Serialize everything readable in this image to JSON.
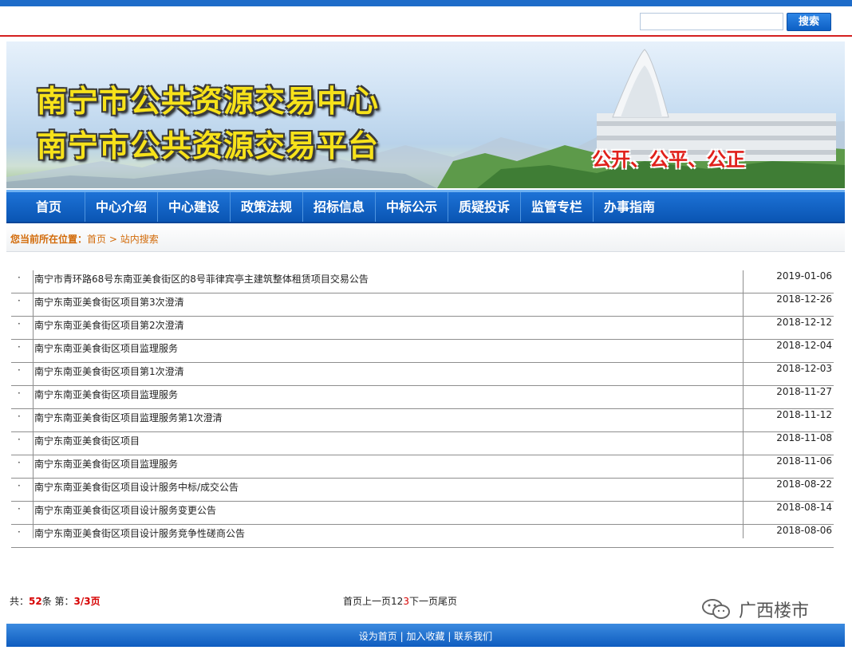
{
  "search": {
    "placeholder": "",
    "button_label": "搜索"
  },
  "banner": {
    "title_line1": "南宁市公共资源交易中心",
    "title_line2": "南宁市公共资源交易平台",
    "slogan": "公开、公平、公正"
  },
  "nav": {
    "items": [
      "首页",
      "中心介绍",
      "中心建设",
      "政策法规",
      "招标信息",
      "中标公示",
      "质疑投诉",
      "监管专栏",
      "办事指南"
    ]
  },
  "breadcrumb": {
    "label": "您当前所在位置：",
    "home": "首页",
    "separator": " > ",
    "current": "站内搜索"
  },
  "results": [
    {
      "bullet": "·",
      "title": "南宁市青环路68号东南亚美食街区的8号菲律宾亭主建筑整体租赁项目交易公告",
      "date": "2019-01-06"
    },
    {
      "bullet": "·",
      "title": "南宁东南亚美食街区项目第3次澄清",
      "date": "2018-12-26"
    },
    {
      "bullet": "·",
      "title": "南宁东南亚美食街区项目第2次澄清",
      "date": "2018-12-12"
    },
    {
      "bullet": "·",
      "title": "南宁东南亚美食街区项目监理服务",
      "date": "2018-12-04"
    },
    {
      "bullet": "·",
      "title": "南宁东南亚美食街区项目第1次澄清",
      "date": "2018-12-03"
    },
    {
      "bullet": "·",
      "title": "南宁东南亚美食街区项目监理服务",
      "date": "2018-11-27"
    },
    {
      "bullet": "·",
      "title": "南宁东南亚美食街区项目监理服务第1次澄清",
      "date": "2018-11-12"
    },
    {
      "bullet": "·",
      "title": "南宁东南亚美食街区项目",
      "date": "2018-11-08"
    },
    {
      "bullet": "·",
      "title": "南宁东南亚美食街区项目监理服务",
      "date": "2018-11-06"
    },
    {
      "bullet": "·",
      "title": "南宁东南亚美食街区项目设计服务中标/成交公告",
      "date": "2018-08-22"
    },
    {
      "bullet": "·",
      "title": "南宁东南亚美食街区项目设计服务变更公告",
      "date": "2018-08-14"
    },
    {
      "bullet": "·",
      "title": "南宁东南亚美食街区项目设计服务竞争性磋商公告",
      "date": "2018-08-06"
    }
  ],
  "pager": {
    "total_prefix": "共：",
    "total_count": "52",
    "total_suffix": "条 第：",
    "page_current": "3/3",
    "page_suffix": "页",
    "first": "首页",
    "prev": "上一页",
    "pages": [
      "1",
      "2",
      "3"
    ],
    "current_page": "3",
    "next": "下一页",
    "last": "尾页"
  },
  "watermark": {
    "text": "广西楼市",
    "icon": "wechat-icon"
  },
  "footer": {
    "set_home": "设为首页",
    "add_fav": "加入收藏",
    "contact": "联系我们",
    "divider": " | "
  },
  "colors": {
    "nav_blue": "#0a55b3",
    "breadcrumb_orange": "#d26b0a",
    "highlight_red": "#d60000",
    "top_red_line": "#d42020"
  }
}
